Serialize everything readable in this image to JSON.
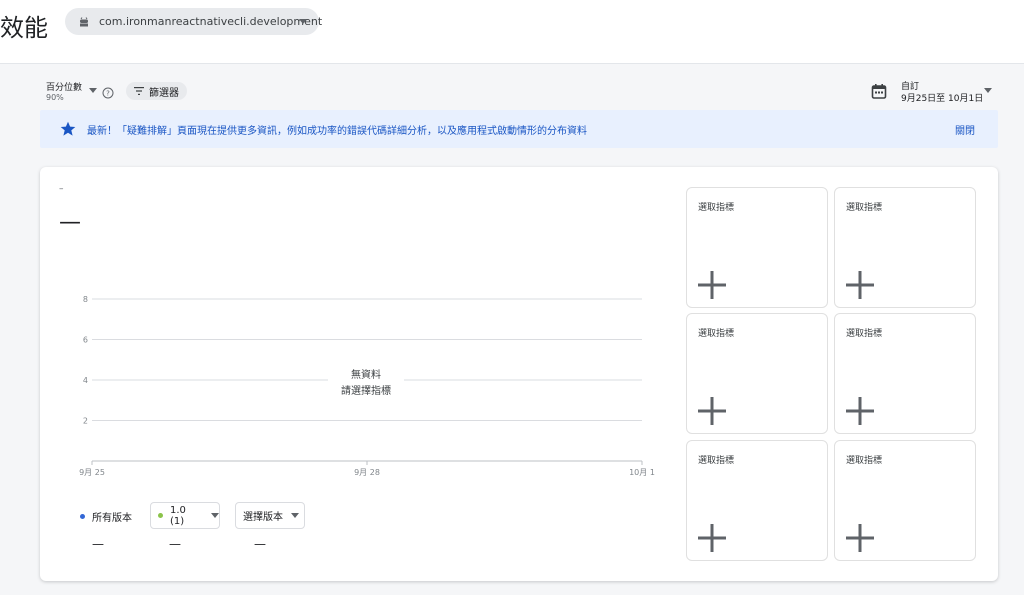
{
  "header": {
    "title": "效能",
    "app": "com.ironmanreactnativecli.development"
  },
  "filters": {
    "percentile_label": "百分位數",
    "percentile_value": "90%",
    "filter_label": "篩選器",
    "date_label": "自訂",
    "date_range": "9月25日至 10月1日"
  },
  "banner": {
    "message": "最新！「疑難排解」頁面現在提供更多資訊，例如成功率的錯誤代碼詳細分析，以及應用程式啟動情形的分布資料",
    "close": "關閉"
  },
  "metric": {
    "subtitle": "–",
    "value": "—"
  },
  "chart_data": {
    "type": "line",
    "series": [],
    "x_ticks": [
      "9月 25",
      "9月 28",
      "10月 1"
    ],
    "y_ticks": [
      "2",
      "4",
      "6",
      "8"
    ],
    "ylim": [
      0,
      8
    ],
    "grid": true,
    "empty_line1": "無資料",
    "empty_line2": "請選擇指標"
  },
  "versions": {
    "all_label": "所有版本",
    "all_color": "#3367d6",
    "v1_label": "1.0 (1)",
    "v1_color": "#8bc34a",
    "select_label": "選擇版本",
    "dash1": "—",
    "dash2": "—",
    "dash3": "—"
  },
  "tiles": [
    {
      "label": "選取指標"
    },
    {
      "label": "選取指標"
    },
    {
      "label": "選取指標"
    },
    {
      "label": "選取指標"
    },
    {
      "label": "選取指標"
    },
    {
      "label": "選取指標"
    }
  ]
}
